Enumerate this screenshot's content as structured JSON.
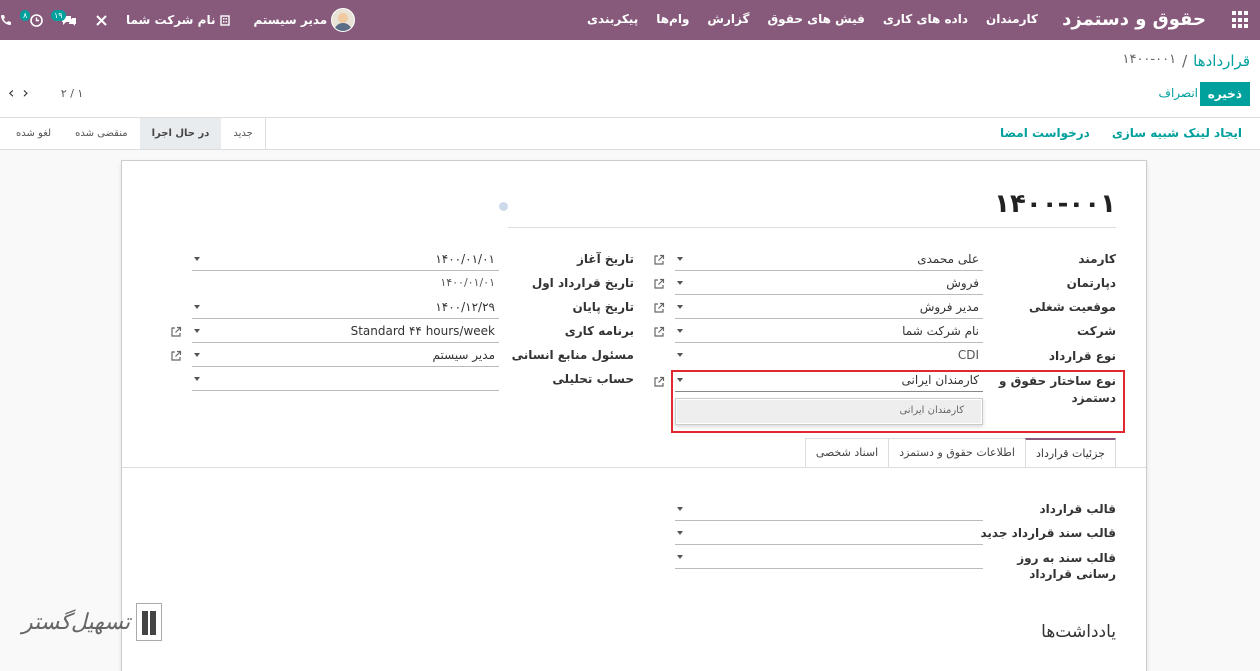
{
  "navbar": {
    "app_title": "حقوق و دستمزد",
    "menu": [
      "کارمندان",
      "داده های کاری",
      "فیش های حقوق",
      "گزارش",
      "وام‌ها",
      "پیکربندی"
    ],
    "user_name": "مدیر سیستم",
    "company_name": "نام شرکت شما",
    "activity_badge": "۸",
    "messages_badge": "۱۹"
  },
  "breadcrumb": {
    "parent": "قراردادها",
    "separator": "/",
    "current": "۱۴۰۰-۰۰۱"
  },
  "buttons": {
    "save": "ذخیره",
    "discard": "انصراف"
  },
  "pager": {
    "value": "۲ / ۱"
  },
  "status_actions": [
    "ایجاد لینک شبیه سازی",
    "درخواست امضا"
  ],
  "stages": [
    {
      "label": "لغو شده",
      "active": false
    },
    {
      "label": "منقضی شده",
      "active": false
    },
    {
      "label": "در حال اجرا",
      "active": true
    },
    {
      "label": "جدید",
      "active": false
    }
  ],
  "form": {
    "title": "۱۴۰۰-۰۰۱",
    "right_fields": [
      {
        "label": "کارمند",
        "value": "علی محمدی"
      },
      {
        "label": "دپارتمان",
        "value": "فروش"
      },
      {
        "label": "موقعیت شغلی",
        "value": "مدیر فروش"
      },
      {
        "label": "شرکت",
        "value": "نام شرکت شما"
      },
      {
        "label": "نوع قرارداد",
        "value": "CDI"
      },
      {
        "label": "نوع ساختار حقوق و دستمزد",
        "value": "کارمندان ایرانی"
      }
    ],
    "left_fields": [
      {
        "label": "تاریخ آغاز",
        "value": "۱۴۰۰/۰۱/۰۱"
      },
      {
        "label": "تاریخ قرارداد اول",
        "value": "۱۴۰۰/۰۱/۰۱"
      },
      {
        "label": "تاریخ پایان",
        "value": "۱۴۰۰/۱۲/۲۹"
      },
      {
        "label": "برنامه کاری",
        "value": "Standard ۴۴ hours/week"
      },
      {
        "label": "مسئول منابع انسانی",
        "value": "مدیر سیستم"
      },
      {
        "label": "حساب تحلیلی",
        "value": ""
      }
    ],
    "dropdown_option": "کارمندان ایرانی",
    "tabs": [
      "جزئیات قرارداد",
      "اطلاعات حقوق و دستمزد",
      "اسناد شخصی"
    ],
    "tab_fields": [
      {
        "label": "قالب قرارداد",
        "value": ""
      },
      {
        "label": "قالب سند قرارداد جدید",
        "value": ""
      },
      {
        "label": "قالب سند به روز رسانی قرارداد",
        "value": ""
      }
    ],
    "notes_title": "یادداشت‌ها"
  },
  "watermark": {
    "text": "تسهیل‌گستر"
  },
  "colors": {
    "navbar": "#875a7b",
    "primary": "#00a09d",
    "highlight": "#e0282e"
  }
}
